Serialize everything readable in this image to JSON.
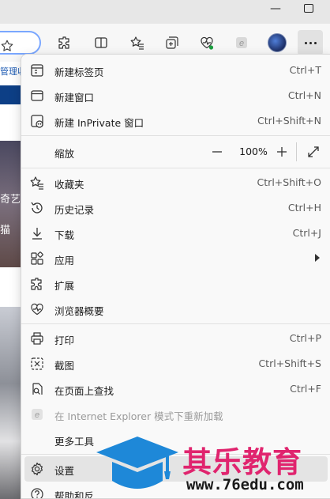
{
  "window": {
    "minimize_glyph": "—"
  },
  "toolbar": {
    "icons": [
      "star-icon",
      "extensions-icon",
      "split-screen-icon",
      "favorites-icon",
      "collections-icon",
      "browser-essentials-icon",
      "internet-explorer-icon",
      "profile-avatar",
      "more-icon"
    ]
  },
  "background_page": {
    "link_fragment": "管理收",
    "text1": "奇艺",
    "text2": "猫"
  },
  "menu": {
    "new_tab": {
      "label": "新建标签页",
      "shortcut": "Ctrl+T"
    },
    "new_window": {
      "label": "新建窗口",
      "shortcut": "Ctrl+N"
    },
    "new_inprivate": {
      "label": "新建 InPrivate 窗口",
      "shortcut": "Ctrl+Shift+N"
    },
    "zoom": {
      "label": "缩放",
      "value": "100%",
      "minus": "—",
      "plus": "+"
    },
    "favorites": {
      "label": "收藏夹",
      "shortcut": "Ctrl+Shift+O"
    },
    "history": {
      "label": "历史记录",
      "shortcut": "Ctrl+H"
    },
    "downloads": {
      "label": "下载",
      "shortcut": "Ctrl+J"
    },
    "apps": {
      "label": "应用"
    },
    "extensions": {
      "label": "扩展"
    },
    "essentials": {
      "label": "浏览器概要"
    },
    "print": {
      "label": "打印",
      "shortcut": "Ctrl+P"
    },
    "screenshot": {
      "label": "截图",
      "shortcut": "Ctrl+Shift+S"
    },
    "find": {
      "label": "在页面上查找",
      "shortcut": "Ctrl+F"
    },
    "ie_mode": {
      "label": "在 Internet Explorer 模式下重新加载"
    },
    "more_tools": {
      "label": "更多工具"
    },
    "settings": {
      "label": "设置"
    },
    "help": {
      "label": "帮助和反"
    }
  },
  "watermark": {
    "brand": "其乐教育",
    "url": "www.76edu.com"
  },
  "colors": {
    "accent": "#0067c0",
    "watermark_pink": "#e0246e",
    "watermark_blue": "#1e88d8"
  }
}
